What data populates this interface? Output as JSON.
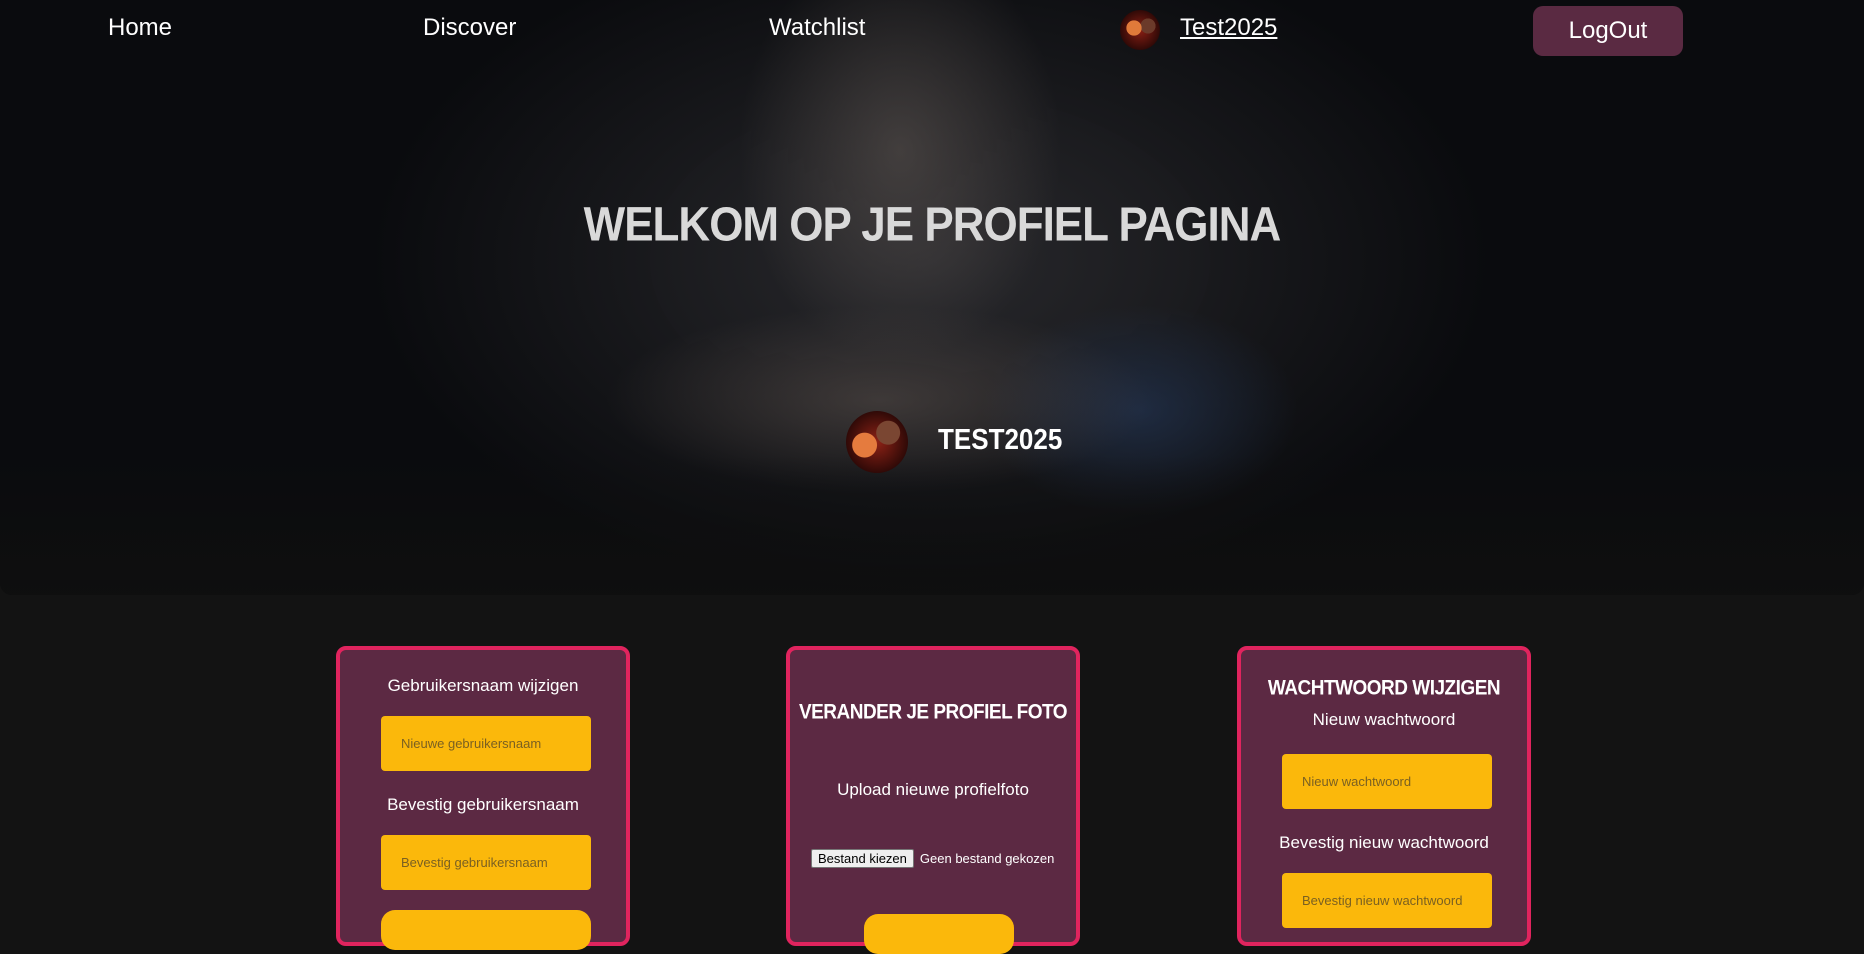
{
  "nav": {
    "home": "Home",
    "discover": "Discover",
    "watchlist": "Watchlist",
    "username": "Test2025",
    "logout": "LogOut"
  },
  "hero": {
    "title": "WELKOM OP JE PROFIEL PAGINA",
    "profile_name": "TEST2025"
  },
  "cards": {
    "username": {
      "label_new": "Gebruikersnaam wijzigen",
      "placeholder_new": "Nieuwe gebruikersnaam",
      "label_confirm": "Bevestig gebruikersnaam",
      "placeholder_confirm": "Bevestig gebruikersnaam"
    },
    "photo": {
      "heading": "VERANDER JE PROFIEL FOTO",
      "upload_label": "Upload nieuwe profielfoto",
      "file_button": "Bestand kiezen",
      "file_status": "Geen bestand gekozen"
    },
    "password": {
      "heading": "WACHTWOORD WIJZIGEN",
      "label_new": "Nieuw wachtwoord",
      "placeholder_new": "Nieuw wachtwoord",
      "label_confirm": "Bevestig nieuw wachtwoord",
      "placeholder_confirm": "Bevestig nieuw wachtwoord"
    }
  },
  "colors": {
    "card_bg": "#5c2943",
    "card_border": "#e0245e",
    "input_bg": "#fbb80b",
    "logout_bg": "#5a2a42",
    "page_bg": "#131313"
  }
}
